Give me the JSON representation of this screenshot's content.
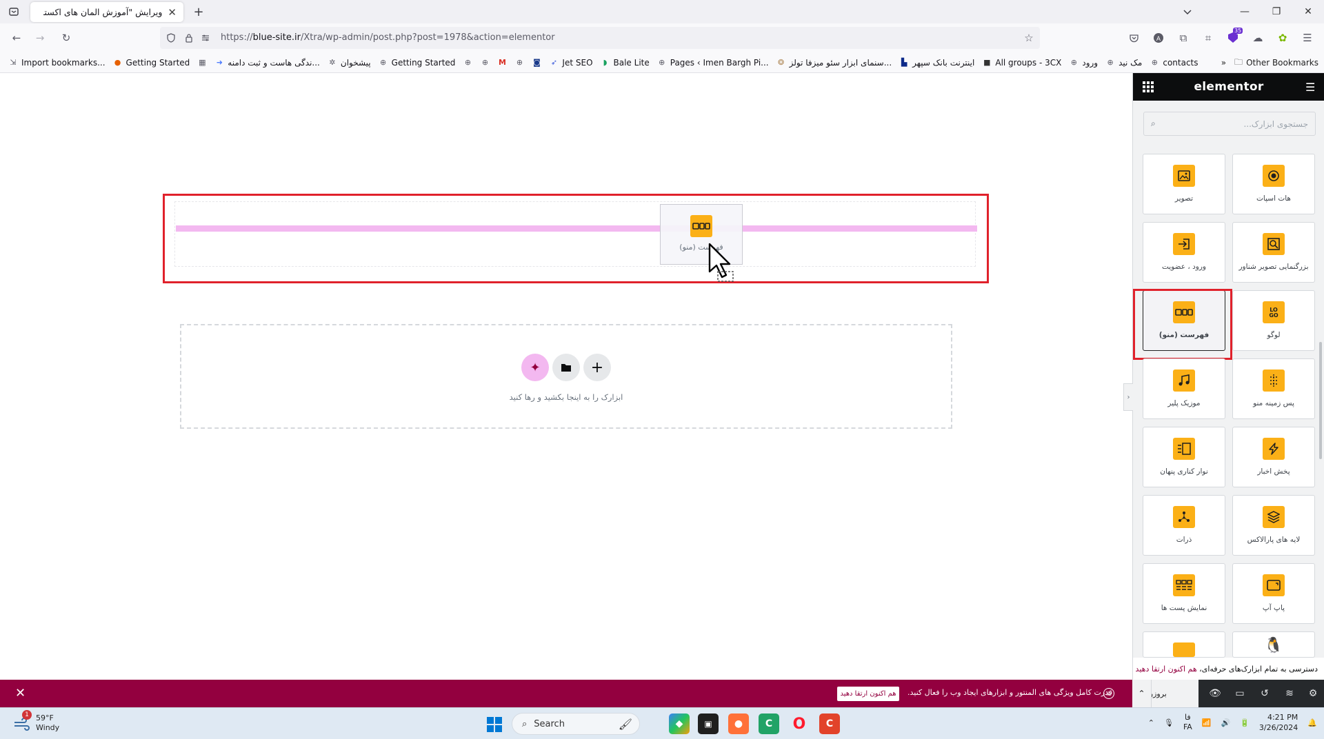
{
  "browser": {
    "tab_title": "ویرایش \"آموزش المان های اکسترا - ع...",
    "url_prefix": "https://",
    "url_domain": "blue-site.ir",
    "url_path": "/Xtra/wp-admin/post.php?post=1978&action=elementor",
    "extension_badge": "35",
    "bookmarks": [
      {
        "label": "Import bookmarks...",
        "icon": "import-icon"
      },
      {
        "label": "Getting Started",
        "icon": "firefox-icon"
      },
      {
        "label": "",
        "icon": "calendar-icon"
      },
      {
        "label": "...ندگی هاست و ثبت دامنه",
        "icon": "arrow-icon"
      },
      {
        "label": "پیشخوان",
        "icon": "wp-icon"
      },
      {
        "label": "Getting Started",
        "icon": "globe-icon"
      },
      {
        "label": "",
        "icon": "globe-icon"
      },
      {
        "label": "",
        "icon": "globe-icon"
      },
      {
        "label": "",
        "icon": "gmail-icon"
      },
      {
        "label": "",
        "icon": "globe-icon"
      },
      {
        "label": "",
        "icon": "app-icon"
      },
      {
        "label": "Jet SEO",
        "icon": "rocket-icon"
      },
      {
        "label": "Bale Lite",
        "icon": "bale-icon"
      },
      {
        "label": "Pages ‹ Imen Bargh Pi...",
        "icon": "globe-icon"
      },
      {
        "label": "...سنمای ابزار سئو میزفا تولز",
        "icon": "tools-icon"
      },
      {
        "label": "اینترنت بانک سپهر",
        "icon": "bank-icon"
      },
      {
        "label": "All groups - 3CX",
        "icon": "3cx-icon"
      },
      {
        "label": "ورود",
        "icon": "globe-icon"
      },
      {
        "label": "مک نید",
        "icon": "globe-icon"
      },
      {
        "label": "contacts",
        "icon": "globe-icon"
      }
    ],
    "other_bookmarks": "Other Bookmarks"
  },
  "canvas": {
    "drag_ghost_label": "فهرست (منو)",
    "drop_hint": "ابزارک را به اینجا بکشید و رها کنید"
  },
  "panel": {
    "title": "elementor",
    "search_placeholder": "جستجوی ابزارک...",
    "widgets": [
      {
        "label": "هات اسپات",
        "icon": "hotspot-icon"
      },
      {
        "label": "تصویر",
        "icon": "image-icon"
      },
      {
        "label": "بزرگنمایی تصویر شناور",
        "icon": "zoom-image-icon"
      },
      {
        "label": "ورود ، عضویت",
        "icon": "login-icon"
      },
      {
        "label": "لوگو",
        "icon": "logo-icon"
      },
      {
        "label": "فهرست (منو)",
        "icon": "nav-menu-icon"
      },
      {
        "label": "پس زمینه منو",
        "icon": "menu-background-icon"
      },
      {
        "label": "موزیک پلیر",
        "icon": "music-icon"
      },
      {
        "label": "پخش اخبار",
        "icon": "flash-icon"
      },
      {
        "label": "نوار کناری پنهان",
        "icon": "sidebar-icon"
      },
      {
        "label": "لایه های پارالاکس",
        "icon": "layers-icon"
      },
      {
        "label": "ذرات",
        "icon": "particles-icon"
      },
      {
        "label": "پاپ آپ",
        "icon": "popup-icon"
      },
      {
        "label": "نمایش پست ها",
        "icon": "posts-icon"
      }
    ],
    "promo_text": "دسترسی به تمام ابزارک‌های حرفه‌ای،",
    "promo_link": "هم اکنون ارتقا دهید",
    "publish_label": "بروزرسانی"
  },
  "notice": {
    "text": "قدرت کامل ویژگی های المنتور و ابزارهای ایجاد وب را فعال کنید.",
    "cta": "هم اکنون ارتقا دهید"
  },
  "taskbar": {
    "notification_count": "1",
    "temperature": "59°F",
    "weather": "Windy",
    "search_label": "Search",
    "language_top": "فا",
    "language_bottom": "FA",
    "time": "4:21 PM",
    "date": "3/26/2024"
  },
  "colors": {
    "accent_red": "#e0212b",
    "elementor_magenta": "#93003f",
    "widget_yellow": "#fbb017",
    "drop_indicator": "#f3b8f0"
  }
}
